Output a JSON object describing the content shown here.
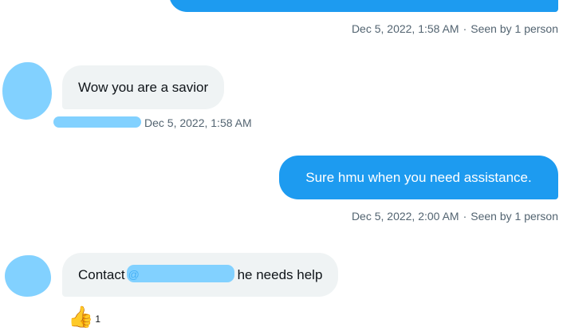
{
  "messages": {
    "m1": {
      "meta": "Dec 5, 2022, 1:58 AM",
      "seen": "Seen by 1 person"
    },
    "m2": {
      "text": "Wow you are a savior",
      "meta": "Dec 5, 2022, 1:58 AM"
    },
    "m3": {
      "text": "Sure hmu when you need assistance.",
      "meta": "Dec 5, 2022, 2:00 AM",
      "seen": "Seen by 1 person"
    },
    "m4": {
      "prefix": "Contact",
      "at": "@",
      "suffix": "he needs help"
    }
  },
  "reaction": {
    "emoji": "👍",
    "count": "1"
  },
  "separator": "·",
  "colors": {
    "outgoing": "#1d9bf0",
    "incoming": "#eff3f4",
    "redaction": "#82d1ff",
    "meta": "#536471"
  }
}
